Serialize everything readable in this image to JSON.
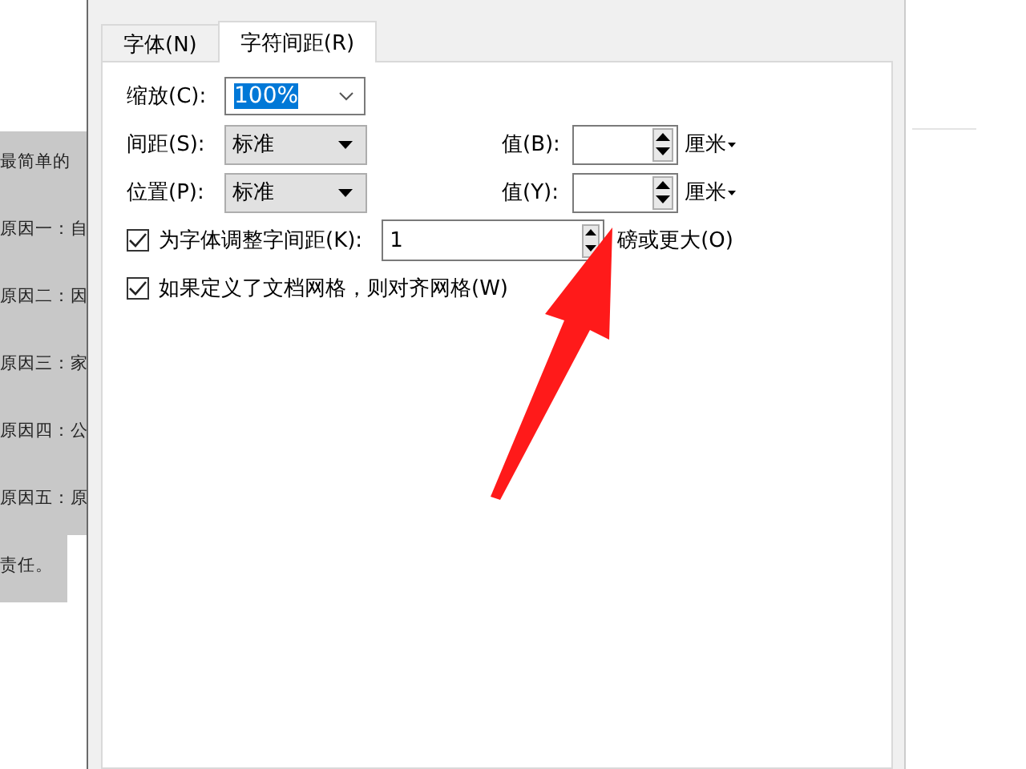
{
  "document": {
    "lines": [
      "最简单的",
      "原因一：自",
      "原因二：因",
      "原因三：家",
      "原因四：公",
      "原因五：原",
      "责任。"
    ]
  },
  "dialog": {
    "tabs": [
      {
        "label": "字体(N)",
        "selected": false
      },
      {
        "label": "字符间距(R)",
        "selected": true
      }
    ],
    "scale": {
      "label": "缩放(C):",
      "value": "100%"
    },
    "spacing": {
      "label": "间距(S):",
      "value": "标准",
      "value_label": "值(B):",
      "unit": "厘米"
    },
    "position": {
      "label": "位置(P):",
      "value": "标准",
      "value_label": "值(Y):",
      "unit": "厘米"
    },
    "kerning": {
      "label": "为字体调整字间距(K):",
      "checked": true,
      "value": "1",
      "suffix": "磅或更大(O)"
    },
    "grid": {
      "label": "如果定义了文档网格，则对齐网格(W)",
      "checked": true
    }
  }
}
